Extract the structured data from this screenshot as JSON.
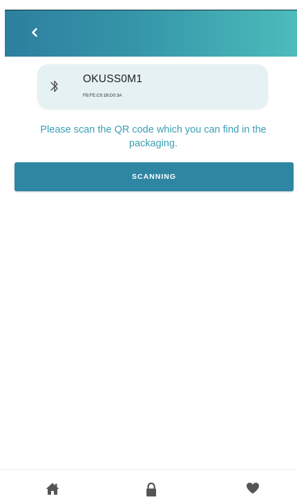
{
  "header": {
    "back_icon": "chevron-left-icon",
    "background_start": "#2d7f9f",
    "background_end": "#4cbcbc"
  },
  "device": {
    "icon": "bluetooth-icon",
    "name": "OKUSS0M1",
    "mac": "FB:FE:C9:1B:D0:3A"
  },
  "instruction": {
    "text": "Please scan the QR code which you can find in the packaging."
  },
  "scan_button": {
    "label": "SCANNING",
    "color": "#2f86a3"
  },
  "bottom_nav": {
    "items": [
      {
        "icon": "home-icon"
      },
      {
        "icon": "lock-icon"
      },
      {
        "icon": "heart-icon"
      }
    ],
    "icon_color": "#555555"
  },
  "accent_text_color": "#3a9fb3"
}
